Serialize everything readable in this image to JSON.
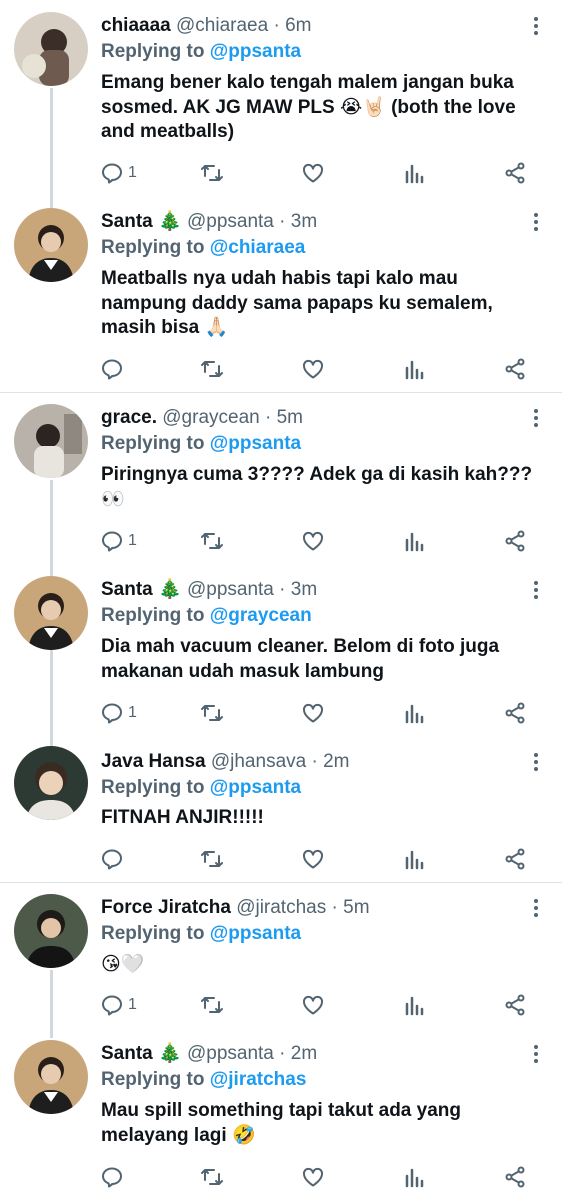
{
  "tweets": [
    {
      "name": "chiaaaa",
      "handle": "@chiaraea",
      "time": "· 6m",
      "reply_prefix": "Replying to",
      "reply_to": "@ppsanta",
      "text": "Emang bener kalo tengah malem jangan buka sosmed. AK JG MAW PLS 😭🤘🏻 (both the love and meatballs)",
      "reply_count": "1"
    },
    {
      "name": "Santa 🎄",
      "handle": "@ppsanta",
      "time": "· 3m",
      "reply_prefix": "Replying to",
      "reply_to": "@chiaraea",
      "text": "Meatballs nya udah habis tapi kalo mau nampung daddy sama papaps ku semalem, masih bisa 🙏🏻",
      "reply_count": ""
    },
    {
      "name": "grace.",
      "handle": "@graycean",
      "time": "· 5m",
      "reply_prefix": "Replying to",
      "reply_to": "@ppsanta",
      "text": "Piringnya cuma 3???? Adek ga di kasih kah??? 👀",
      "reply_count": "1"
    },
    {
      "name": "Santa 🎄",
      "handle": "@ppsanta",
      "time": "· 3m",
      "reply_prefix": "Replying to",
      "reply_to": "@graycean",
      "text": "Dia mah vacuum cleaner. Belom di foto juga makanan udah masuk lambung",
      "reply_count": "1"
    },
    {
      "name": "Java Hansa",
      "handle": "@jhansava",
      "time": "· 2m",
      "reply_prefix": "Replying to",
      "reply_to": "@ppsanta",
      "text": "FITNAH ANJIR!!!!!",
      "reply_count": ""
    },
    {
      "name": "Force Jiratcha",
      "handle": "@jiratchas",
      "time": "· 5m",
      "reply_prefix": "Replying to",
      "reply_to": "@ppsanta",
      "text": "😘🤍",
      "reply_count": "1"
    },
    {
      "name": "Santa 🎄",
      "handle": "@ppsanta",
      "time": "· 2m",
      "reply_prefix": "Replying to",
      "reply_to": "@jiratchas",
      "text": "Mau spill something tapi takut ada yang melayang lagi 🤣",
      "reply_count": ""
    }
  ],
  "icons": {
    "reply": "reply-icon",
    "retweet": "retweet-icon",
    "like": "heart-icon",
    "views": "views-icon",
    "share": "share-icon",
    "more": "more-vertical-icon"
  },
  "colors": {
    "text": "#0f1419",
    "muted": "#536471",
    "link": "#1d9bf0",
    "line": "#cfd9de"
  }
}
